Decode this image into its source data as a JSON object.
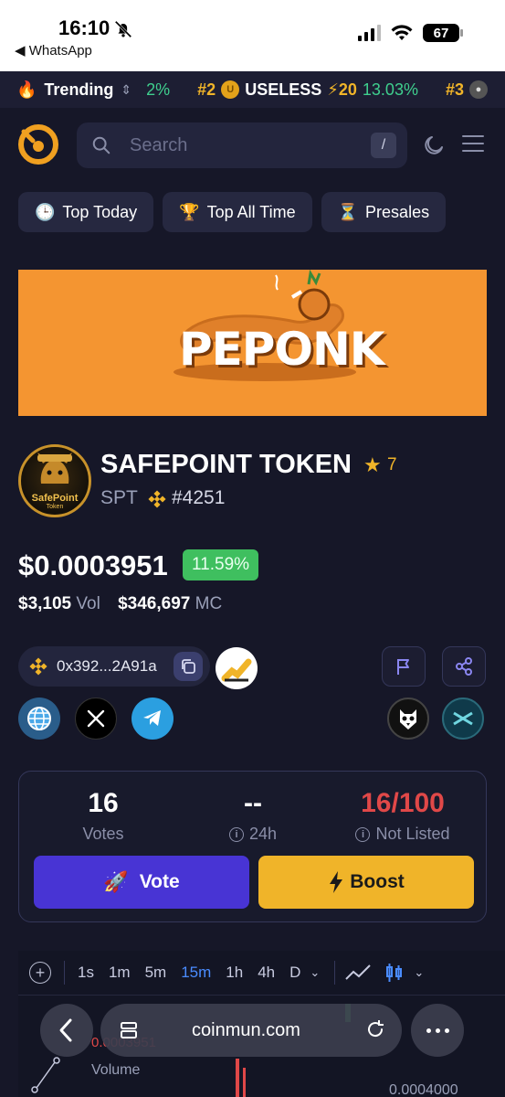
{
  "status_bar": {
    "time": "16:10",
    "back_app": "◀ WhatsApp",
    "battery": "67"
  },
  "trending": {
    "label": "Trending",
    "prev_pct": "2%",
    "rank": "#2",
    "coin_name": "USELESS",
    "boost": "20",
    "change": "13.03%",
    "next_rank": "#3"
  },
  "search": {
    "placeholder": "Search",
    "shortcut": "/"
  },
  "tabs": [
    {
      "icon": "🕒",
      "label": "Top Today"
    },
    {
      "icon": "🏆",
      "label": "Top All Time"
    },
    {
      "icon": "⏳",
      "label": "Presales"
    }
  ],
  "banner": {
    "text": "PEPONK"
  },
  "token": {
    "logo_text": "SafePoint",
    "logo_sub": "Token",
    "name": "SAFEPOINT TOKEN",
    "stars": "7",
    "symbol": "SPT",
    "rank": "#4251",
    "price": "$0.0003951",
    "change": "11.59%",
    "volume": "$3,105",
    "volume_label": "Vol",
    "market_cap": "$346,697",
    "market_cap_label": "MC",
    "contract": "0x392...2A91a"
  },
  "votes": {
    "votes_count": "16",
    "votes_label": "Votes",
    "votes_24h": "--",
    "votes_24h_label": "24h",
    "listing_progress": "16/100",
    "listing_label": "Not Listed",
    "vote_button": "Vote",
    "boost_button": "Boost"
  },
  "chart_toolbar": {
    "timeframes": [
      "1s",
      "1m",
      "5m",
      "15m",
      "1h",
      "4h",
      "D"
    ],
    "active_timeframe": "15m",
    "price_text": "0.0003951",
    "volume_label": "Volume",
    "axis_value": "0.0004000"
  },
  "browser": {
    "url": "coinmun.com"
  },
  "colors": {
    "background": "#161728",
    "accent_purple": "#4834d4",
    "accent_yellow": "#f0b429",
    "positive": "#3fbf5f",
    "negative": "#e04848"
  }
}
